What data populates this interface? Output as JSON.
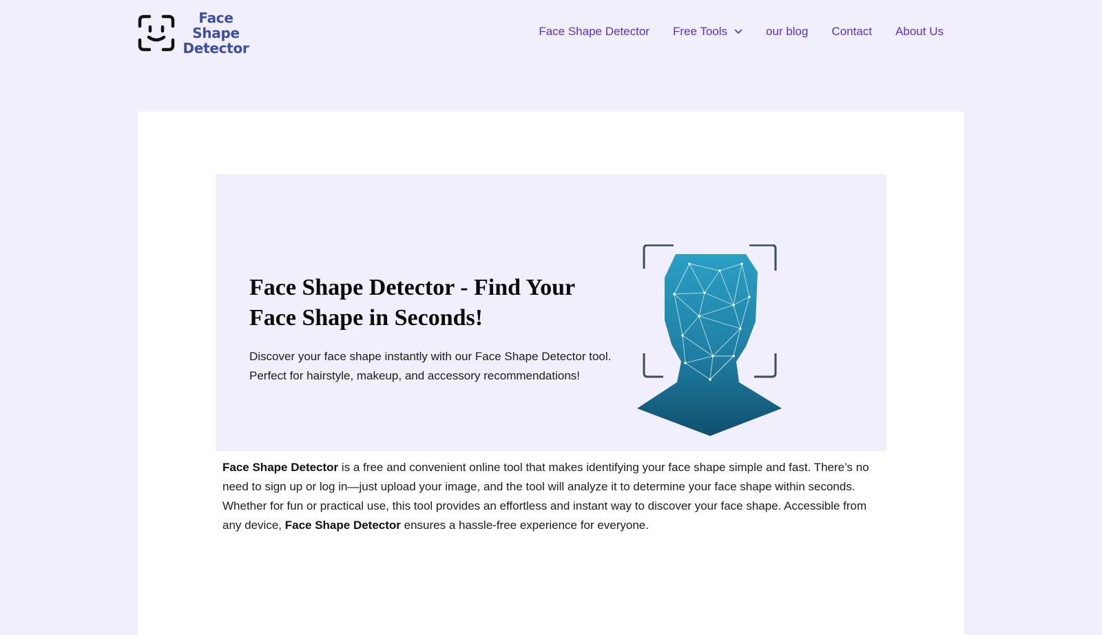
{
  "logo": {
    "line1": "Face Shape",
    "line2": "Detector"
  },
  "nav": {
    "items": [
      {
        "label": "Face Shape Detector"
      },
      {
        "label": "Free Tools",
        "has_dropdown": true
      },
      {
        "label": "our blog"
      },
      {
        "label": "Contact"
      },
      {
        "label": "About Us"
      }
    ]
  },
  "hero": {
    "title": "Face Shape Detector - Find Your Face Shape in Seconds!",
    "description": "Discover your face shape instantly with our Face Shape Detector tool. Perfect for hairstyle, makeup, and accessory recommendations!"
  },
  "intro": {
    "bold_lead": "Face Shape Detector",
    "text_1": " is a free and convenient online tool that makes identifying your face shape simple and fast. There’s no need to sign up or log in—just upload your image, and the tool will analyze it to determine your face shape within seconds. Whether for fun or practical use, this tool provides an effortless and instant way to discover your face shape. Accessible from any device, ",
    "bold_mid": "Face Shape Detector",
    "text_2": " ensures a hassle-free experience for everyone."
  },
  "colors": {
    "page_bg": "#f0effb",
    "nav_link": "#5a2fd8",
    "logo_text": "#3b4fa8",
    "head_teal": "#1f7fa3"
  },
  "icons": [
    "smiley-face-logo-icon",
    "chevron-down-icon",
    "face-scan-illustration"
  ]
}
